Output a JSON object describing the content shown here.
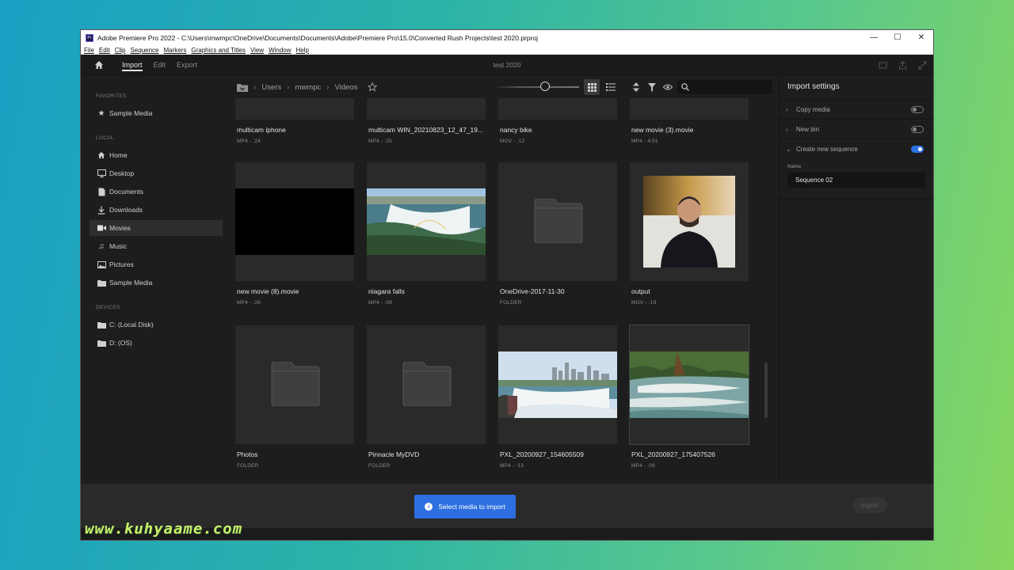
{
  "window": {
    "title": "Adobe Premiere Pro 2022 - C:\\Users\\mwmpc\\OneDrive\\Documents\\Documents\\Adobe\\Premiere Pro\\15.0\\Converted Rush Projects\\test 2020.prproj",
    "app_logo": "Pr",
    "controls": {
      "minimize": "—",
      "maximize": "☐",
      "close": "✕"
    }
  },
  "menubar": [
    "File",
    "Edit",
    "Clip",
    "Sequence",
    "Markers",
    "Graphics and Titles",
    "View",
    "Window",
    "Help"
  ],
  "header": {
    "tabs": [
      {
        "label": "Import",
        "active": true
      },
      {
        "label": "Edit",
        "active": false
      },
      {
        "label": "Export",
        "active": false
      }
    ],
    "project_title": "test 2020"
  },
  "sidebar": {
    "favorites_label": "FAVORITES",
    "favorites": [
      {
        "label": "Sample Media",
        "icon": "star-icon"
      }
    ],
    "local_label": "LOCAL",
    "local": [
      {
        "label": "Home",
        "icon": "home-icon"
      },
      {
        "label": "Desktop",
        "icon": "desktop-icon"
      },
      {
        "label": "Documents",
        "icon": "document-icon"
      },
      {
        "label": "Downloads",
        "icon": "download-icon"
      },
      {
        "label": "Movies",
        "icon": "video-camera-icon",
        "active": true
      },
      {
        "label": "Music",
        "icon": "music-note-icon"
      },
      {
        "label": "Pictures",
        "icon": "image-icon"
      },
      {
        "label": "Sample Media",
        "icon": "folder-icon"
      }
    ],
    "devices_label": "DEVICES",
    "devices": [
      {
        "label": "C: (Local Disk)",
        "icon": "folder-icon"
      },
      {
        "label": "D: (OS)",
        "icon": "folder-icon"
      }
    ]
  },
  "browser": {
    "breadcrumb": [
      "Users",
      "mwmpc",
      "Videos"
    ],
    "search": {
      "placeholder": "",
      "value": ""
    },
    "tiles": [
      {
        "name": "multicam iphone",
        "meta": "MP4 - :24",
        "kind": "video-partial"
      },
      {
        "name": "multicam WIN_20210823_12_47_19...",
        "meta": "MP4 - :25",
        "kind": "video-partial"
      },
      {
        "name": "nancy bike",
        "meta": "MOV - :12",
        "kind": "video-partial"
      },
      {
        "name": "new movie (3).movie",
        "meta": "MP4 - 4:51",
        "kind": "video-partial"
      },
      {
        "name": "new movie (8).movie",
        "meta": "MP4 - :26",
        "kind": "video-black"
      },
      {
        "name": "niagara falls",
        "meta": "MP4 - :09",
        "kind": "video-falls"
      },
      {
        "name": "OneDrive-2017-11-30",
        "meta": "FOLDER",
        "kind": "folder"
      },
      {
        "name": "output",
        "meta": "MOV - :19",
        "kind": "video-person"
      },
      {
        "name": "Photos",
        "meta": "FOLDER",
        "kind": "folder"
      },
      {
        "name": "Pinnacle MyDVD",
        "meta": "FOLDER",
        "kind": "folder"
      },
      {
        "name": "PXL_20200927_154605509",
        "meta": "MP4 - :13",
        "kind": "video-city"
      },
      {
        "name": "PXL_20200927_175407526",
        "meta": "MP4 - :09",
        "kind": "video-river"
      }
    ]
  },
  "import_settings": {
    "title": "Import settings",
    "copy_media": {
      "label": "Copy media",
      "on": false
    },
    "new_bin": {
      "label": "New bin",
      "on": false
    },
    "create_sequence": {
      "label": "Create new sequence",
      "on": true
    },
    "name_label": "Name",
    "name_value": "Sequence 02"
  },
  "footer": {
    "cta_icon": "i",
    "cta_label": "Select media to import",
    "import_label": "Import"
  },
  "watermark": "www.kuhyaame.com",
  "colors": {
    "accent": "#2d6fe0",
    "panel": "#1d1d1d",
    "footer": "#2a2a2a"
  }
}
